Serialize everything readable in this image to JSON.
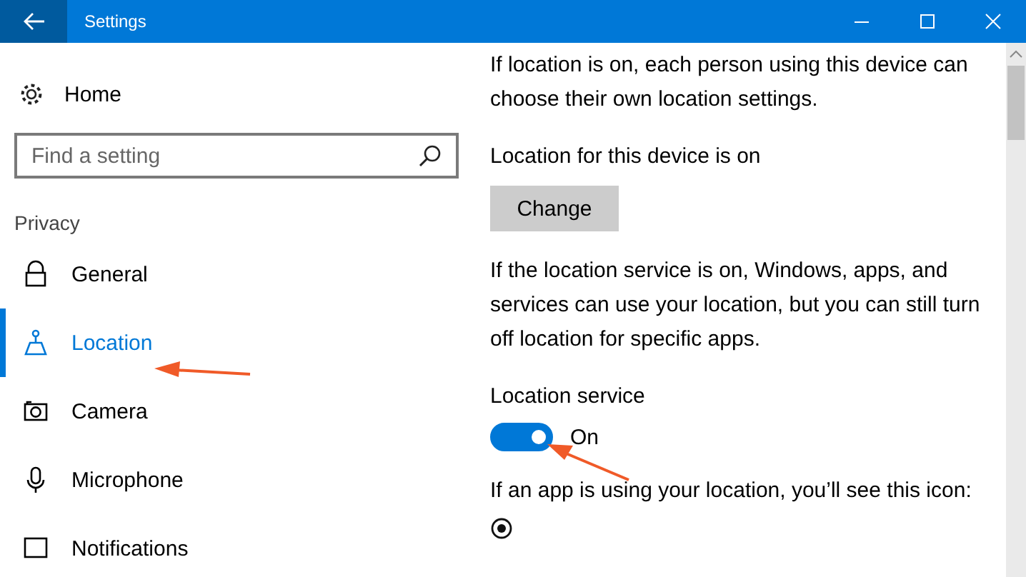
{
  "window": {
    "title": "Settings"
  },
  "sidebar": {
    "home": "Home",
    "search": {
      "placeholder": "Find a setting"
    },
    "section": "Privacy",
    "items": [
      {
        "label": "General",
        "selected": false
      },
      {
        "label": "Location",
        "selected": true
      },
      {
        "label": "Camera",
        "selected": false
      },
      {
        "label": "Microphone",
        "selected": false
      },
      {
        "label": "Notifications",
        "selected": false
      }
    ]
  },
  "content": {
    "intro": "If location is on, each person using this device can choose their own location settings.",
    "device_status": "Location for this device is on",
    "change_button": "Change",
    "service_info": "If the location service is on, Windows, apps, and services can use your location, but you can still turn off location for specific apps.",
    "service_label": "Location service",
    "service_toggle": {
      "on": true,
      "label": "On"
    },
    "icon_info": "If an app is using your location, you’ll see this icon:"
  }
}
